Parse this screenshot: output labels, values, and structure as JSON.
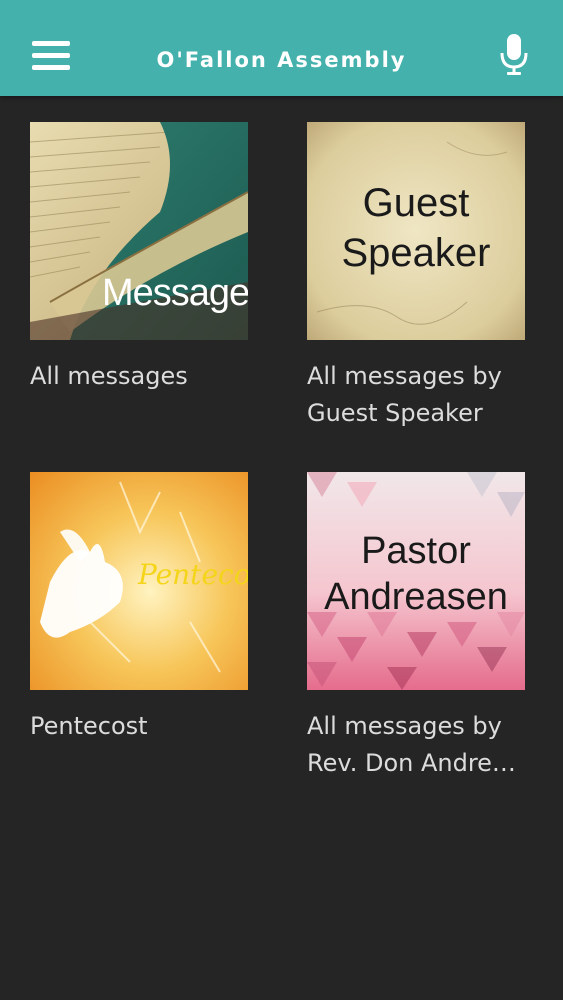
{
  "header": {
    "title": "O'Fallon Assembly",
    "background": "#45b1ac"
  },
  "icons": {
    "menu": "hamburger-menu-icon",
    "mic": "microphone-icon"
  },
  "series_cards": [
    {
      "thumb_text": "Message",
      "caption": "All messages"
    },
    {
      "thumb_text_line1": "Guest",
      "thumb_text_line2": "Speaker",
      "caption_line1": "All messages by",
      "caption_line2": "Guest Speaker"
    },
    {
      "thumb_text": "Pentecost",
      "caption": "Pentecost"
    },
    {
      "thumb_text_line1": "Pastor",
      "thumb_text_line2": "Andreasen",
      "caption_line1": "All messages by",
      "caption_line2": "Rev. Don Andre…"
    }
  ]
}
